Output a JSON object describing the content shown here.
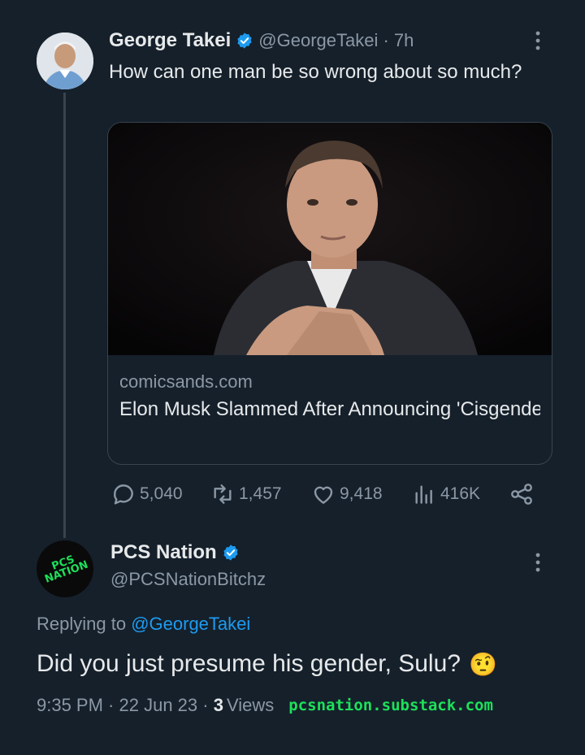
{
  "tweet": {
    "author_name": "George Takei",
    "author_handle": "@GeorgeTakei",
    "age": "7h",
    "text": "How can one man be so wrong about so much?",
    "card": {
      "domain": "comicsands.com",
      "title": "Elon Musk Slammed After Announcing 'Cisgender' Is Now A 'Slur' That Will Get Y..."
    },
    "stats": {
      "replies": "5,040",
      "retweets": "1,457",
      "likes": "9,418",
      "views": "416K"
    }
  },
  "reply": {
    "author_name": "PCS Nation",
    "author_handle": "@PCSNationBitchz",
    "replying_label": "Replying to",
    "replying_to": "@GeorgeTakei",
    "text": "Did you just presume his gender, Sulu?",
    "emoji": "🤨",
    "time": "9:35 PM",
    "date": "22 Jun 23",
    "views_count": "3",
    "views_label": "Views",
    "avatar_text": "PCS NATION"
  },
  "watermark": "pcsnation.substack.com",
  "colors": {
    "background": "#15202b",
    "text": "#e7e9ea",
    "muted": "#8b98a5",
    "accent": "#1d9bf0",
    "watermark": "#1de05a"
  },
  "icons": [
    "verified-badge-icon",
    "more-options-icon",
    "reply-icon",
    "retweet-icon",
    "like-icon",
    "views-icon",
    "share-icon"
  ]
}
